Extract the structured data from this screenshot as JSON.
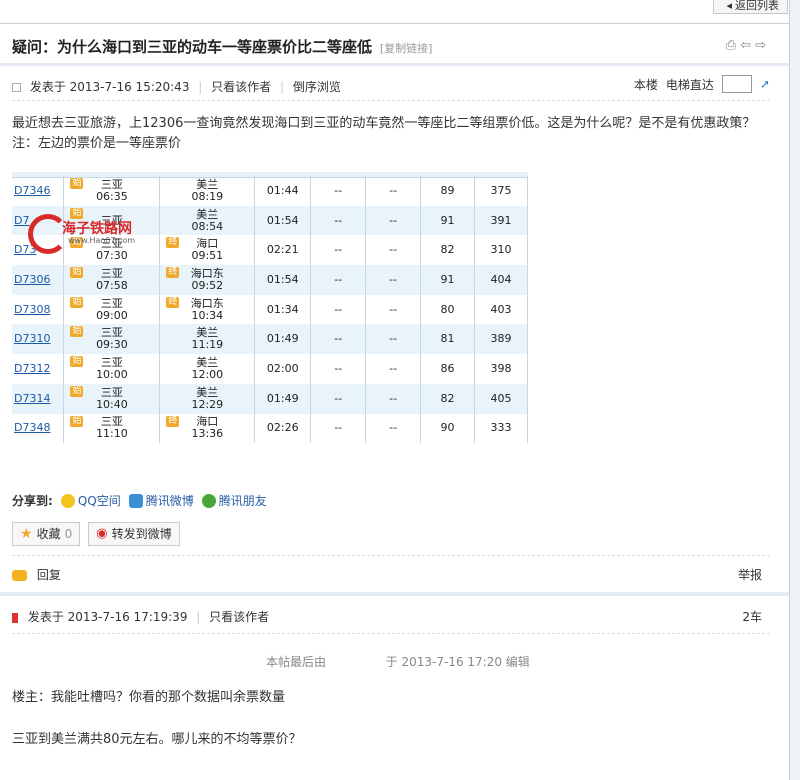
{
  "nav": {
    "back_label": "返回列表"
  },
  "thread": {
    "title": "疑问：为什么海口到三亚的动车一等座票价比二等座低",
    "copy_link": "[复制链接]"
  },
  "post1": {
    "posted_label": "发表于 2013-7-16 15:20:43",
    "only_author": "只看该作者",
    "reverse": "倒序浏览",
    "floor_label": "本楼",
    "elevator": "电梯直达",
    "content_line1": "最近想去三亚旅游，上12306一查询竟然发现海口到三亚的动车竟然一等座比二等组票价低。这是为什么呢？是不是有优惠政策？",
    "content_line2": "注：左边的票价是一等座票价",
    "watermark_text": "海子铁路网",
    "watermark_url": "www.Hao07.com",
    "rows": [
      {
        "train": "D7346",
        "from": "三亚",
        "dep": "06:35",
        "to": "美兰",
        "arr": "08:19",
        "dur": "01:44",
        "c4": "--",
        "c5": "--",
        "c6": "89",
        "c7": "375",
        "to_badge": ""
      },
      {
        "train": "D7",
        "from": "三亚",
        "dep": "",
        "to": "美兰",
        "arr": "08:54",
        "dur": "01:54",
        "c4": "--",
        "c5": "--",
        "c6": "91",
        "c7": "391",
        "to_badge": ""
      },
      {
        "train": "D73",
        "from": "三亚",
        "dep": "07:30",
        "to": "海口",
        "arr": "09:51",
        "dur": "02:21",
        "c4": "--",
        "c5": "--",
        "c6": "82",
        "c7": "310",
        "to_badge": "终"
      },
      {
        "train": "D7306",
        "from": "三亚",
        "dep": "07:58",
        "to": "海口东",
        "arr": "09:52",
        "dur": "01:54",
        "c4": "--",
        "c5": "--",
        "c6": "91",
        "c7": "404",
        "to_badge": "终"
      },
      {
        "train": "D7308",
        "from": "三亚",
        "dep": "09:00",
        "to": "海口东",
        "arr": "10:34",
        "dur": "01:34",
        "c4": "--",
        "c5": "--",
        "c6": "80",
        "c7": "403",
        "to_badge": "终"
      },
      {
        "train": "D7310",
        "from": "三亚",
        "dep": "09:30",
        "to": "美兰",
        "arr": "11:19",
        "dur": "01:49",
        "c4": "--",
        "c5": "--",
        "c6": "81",
        "c7": "389",
        "to_badge": ""
      },
      {
        "train": "D7312",
        "from": "三亚",
        "dep": "10:00",
        "to": "美兰",
        "arr": "12:00",
        "dur": "02:00",
        "c4": "--",
        "c5": "--",
        "c6": "86",
        "c7": "398",
        "to_badge": ""
      },
      {
        "train": "D7314",
        "from": "三亚",
        "dep": "10:40",
        "to": "美兰",
        "arr": "12:29",
        "dur": "01:49",
        "c4": "--",
        "c5": "--",
        "c6": "82",
        "c7": "405",
        "to_badge": ""
      },
      {
        "train": "D7348",
        "from": "三亚",
        "dep": "11:10",
        "to": "海口",
        "arr": "13:36",
        "dur": "02:26",
        "c4": "--",
        "c5": "--",
        "c6": "90",
        "c7": "333",
        "to_badge": "终"
      }
    ],
    "from_badge": "始"
  },
  "share": {
    "label": "分享到:",
    "items": [
      "QQ空间",
      "腾讯微博",
      "腾讯朋友"
    ]
  },
  "actions": {
    "favorite": "收藏",
    "favorite_count": "0",
    "forward": "转发到微博"
  },
  "reply_bar": {
    "reply": "回复",
    "report": "举报"
  },
  "post2": {
    "posted_label": "发表于 2013-7-16 17:19:39",
    "only_author": "只看该作者",
    "floor": "2车",
    "edit_prefix": "本帖最后由",
    "edit_time": "于 2013-7-16 17:20 编辑",
    "line1": "楼主：我能吐槽吗？你看的那个数据叫余票数量",
    "line2": "三亚到美兰满共80元左右。哪儿来的不均等票价？"
  },
  "colors": {
    "link": "#1c5aa6",
    "accent": "#f0a92a",
    "divider": "#e4ebf3"
  }
}
